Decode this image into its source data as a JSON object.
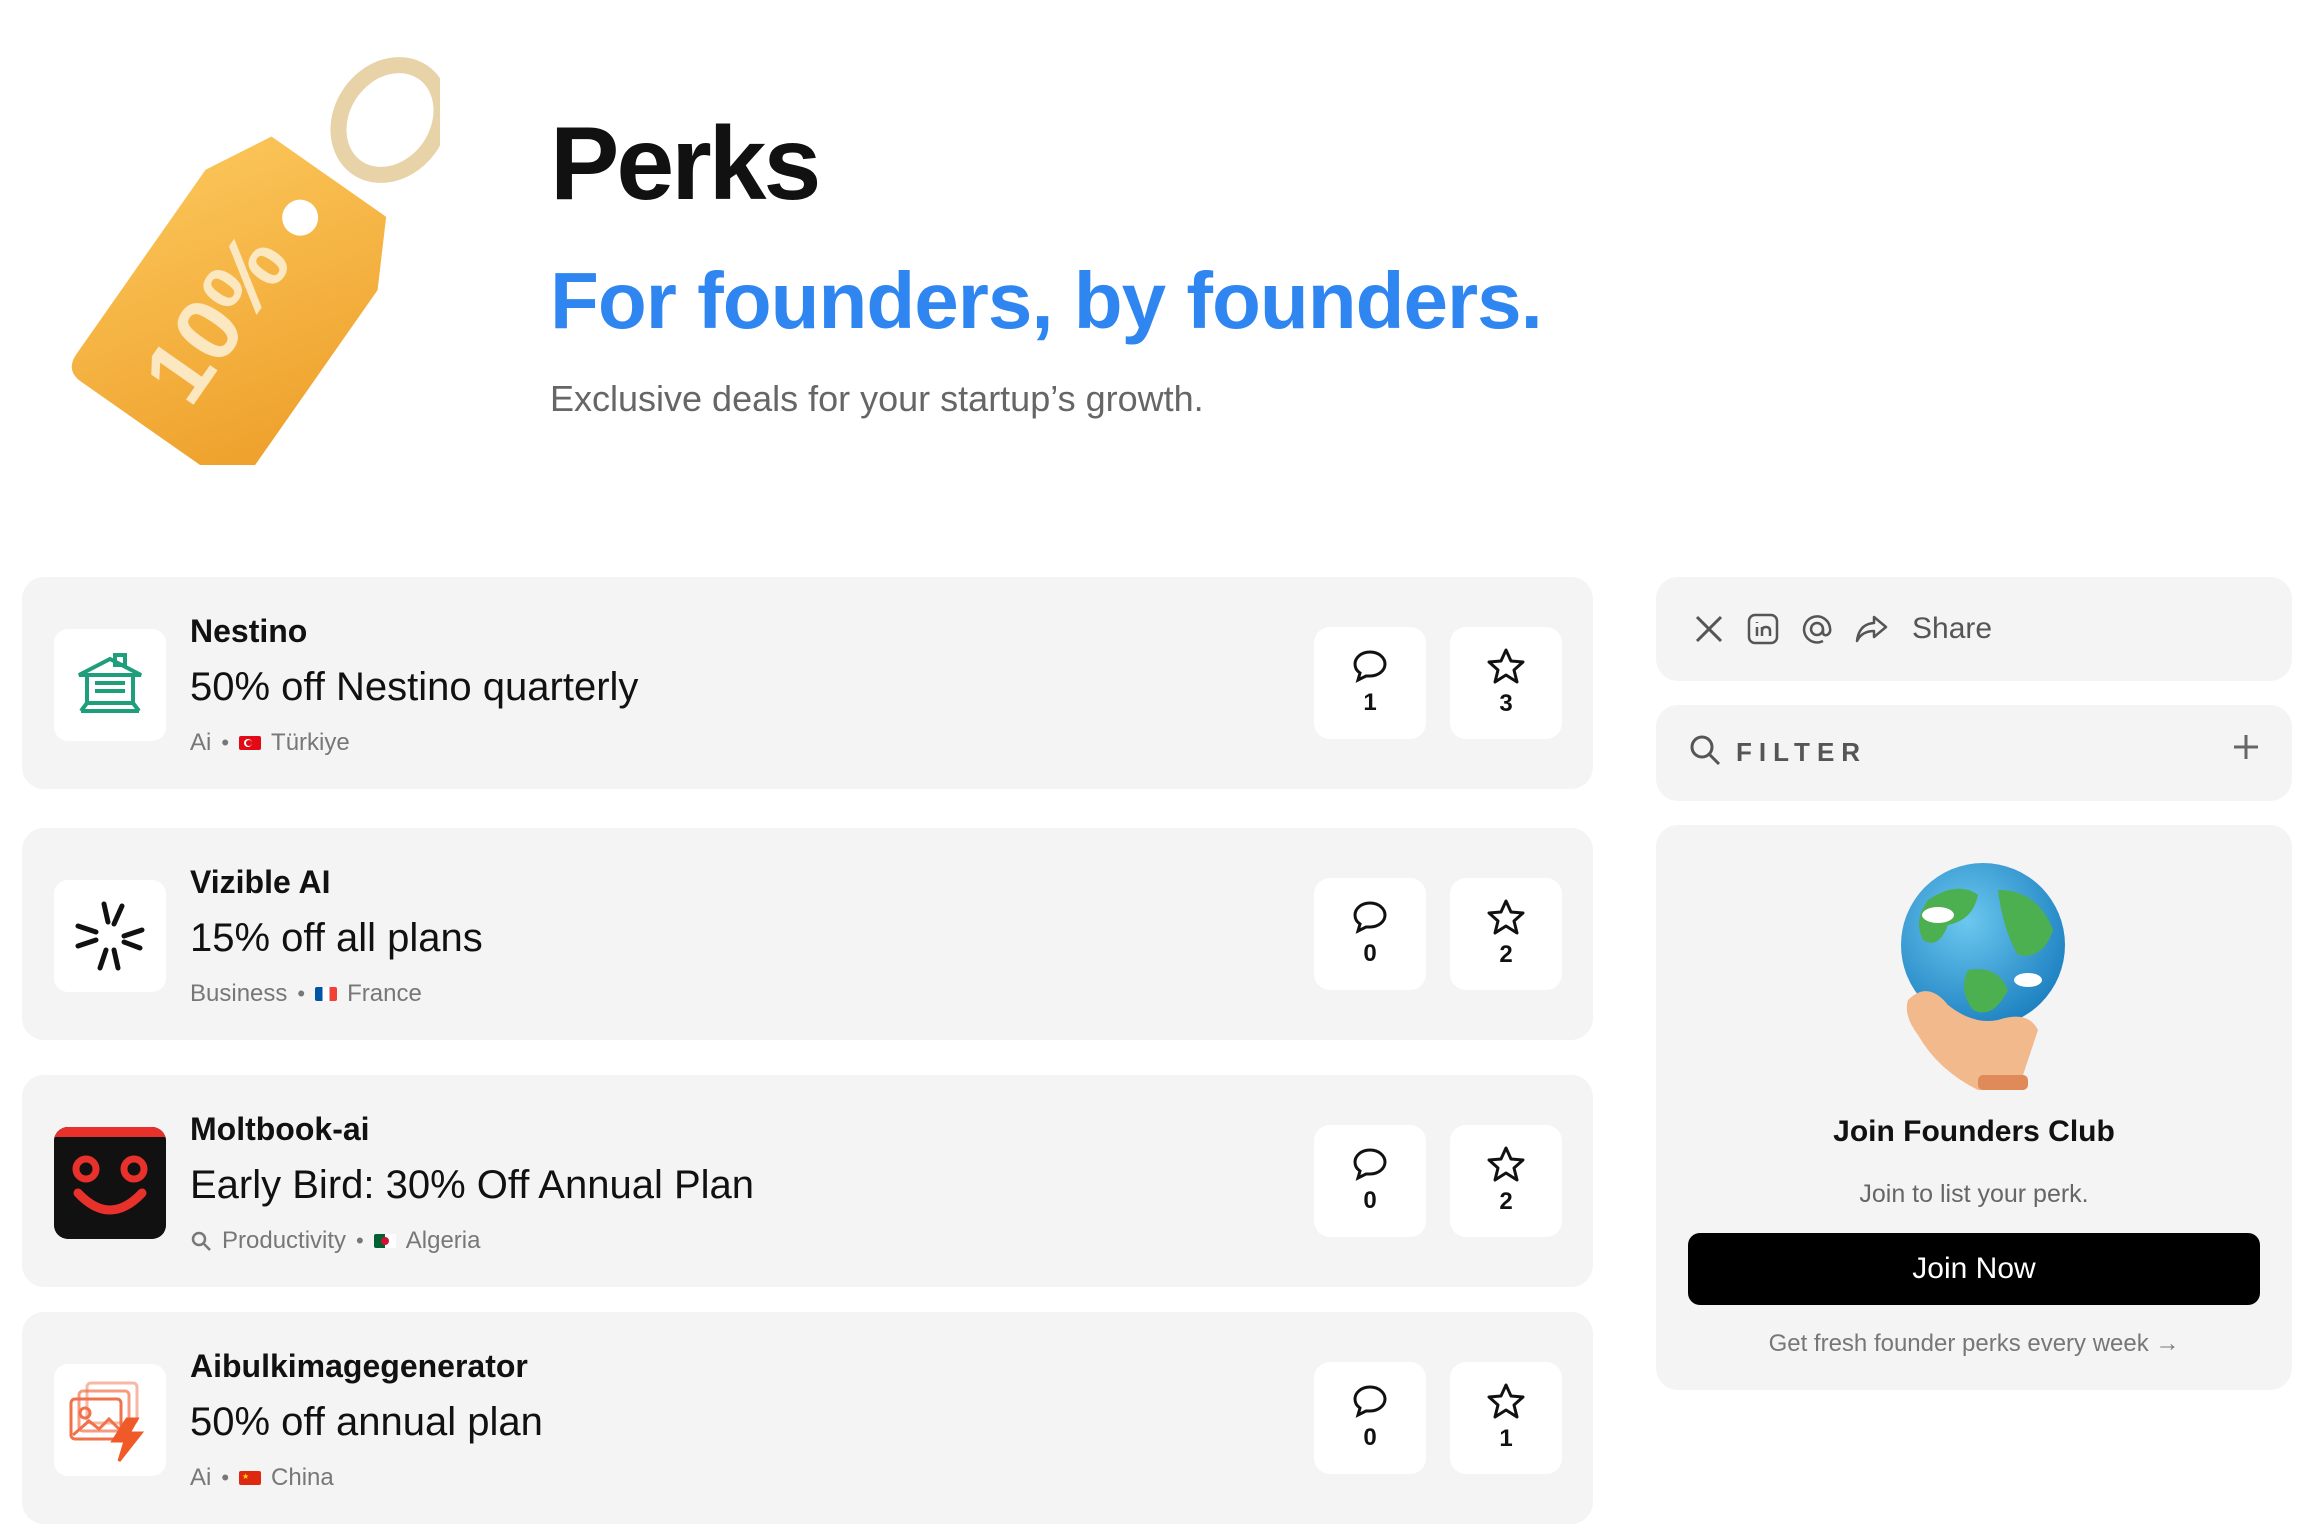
{
  "header": {
    "title": "Perks",
    "tagline": "For founders, by founders.",
    "subtitle": "Exclusive deals for your startup’s growth.",
    "hero_tag_text": "10%"
  },
  "colors": {
    "accent_blue": "#2f86f0",
    "card_bg": "#f4f4f4",
    "tag_orange": "#f6b13c"
  },
  "perks": [
    {
      "name": "Nestino",
      "deal": "50% off Nestino quarterly",
      "category": "Ai",
      "country": "Türkiye",
      "comments": "1",
      "stars": "3",
      "logo_icon": "house-icon"
    },
    {
      "name": "Vizible AI",
      "deal": "15% off all plans",
      "category": "Business",
      "country": "France",
      "comments": "0",
      "stars": "2",
      "logo_icon": "sparkle-burst-icon"
    },
    {
      "name": "Moltbook-ai",
      "deal": "Early Bird: 30% Off Annual Plan",
      "category": "Productivity",
      "country": "Algeria",
      "comments": "0",
      "stars": "2",
      "logo_icon": "smiley-face-icon"
    },
    {
      "name": "Aibulkimagegenerator",
      "deal": "50% off annual plan",
      "category": "Ai",
      "country": "China",
      "comments": "0",
      "stars": "1",
      "logo_icon": "image-bolt-icon"
    }
  ],
  "sidebar": {
    "share_label": "Share",
    "filter_label": "FILTER",
    "club_title": "Join Founders Club",
    "club_subtitle": "Join to list your perk.",
    "join_button": "Join Now",
    "club_link": "Get fresh founder perks every week →"
  }
}
